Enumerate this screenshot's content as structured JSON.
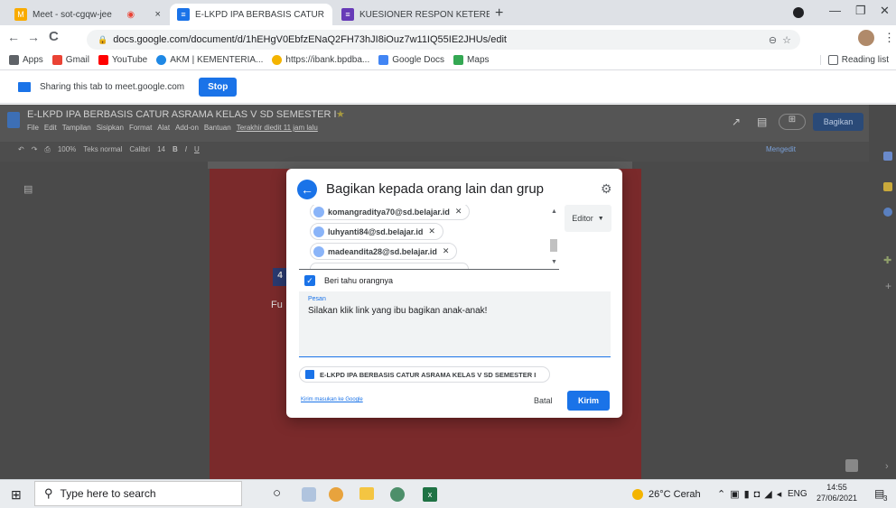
{
  "browser": {
    "tabs": [
      {
        "title": "Meet - sot-cgqw-jee",
        "close": "×",
        "fav_color": "#f9ab00"
      },
      {
        "title": "E-LKPD IPA BERBASIS CATUR",
        "close": "×",
        "fav_color": "#1a73e8"
      },
      {
        "title": "KUESIONER RESPON KETERBACA",
        "close": "×",
        "fav_color": "#673ab7"
      }
    ],
    "new_tab": "+",
    "url": "docs.google.com/document/d/1hEHgV0EbfzENaQ2FH73hJI8iOuz7w11IQ55IE2JHUs/edit",
    "bookmarks": [
      {
        "label": "Apps",
        "color": "#5f6368"
      },
      {
        "label": "Gmail",
        "color": "#ea4335"
      },
      {
        "label": "YouTube",
        "color": "#ff0000"
      },
      {
        "label": "AKM | KEMENTERIA...",
        "color": "#1e88e5"
      },
      {
        "label": "https://ibank.bpdba...",
        "color": "#f4b400"
      },
      {
        "label": "Google Docs",
        "color": "#4285f4"
      },
      {
        "label": "Maps",
        "color": "#34a853"
      }
    ],
    "reading_list": "Reading list"
  },
  "sharebar": {
    "text": "Sharing this tab to meet.google.com",
    "stop": "Stop"
  },
  "docs": {
    "title": "E-LKPD IPA BERBASIS CATUR ASRAMA KELAS V SD SEMESTER I",
    "menu": [
      "File",
      "Edit",
      "Tampilan",
      "Sisipkan",
      "Format",
      "Alat",
      "Add-on",
      "Bantuan"
    ],
    "last_edit": "Terakhir diedit 11 jam lalu",
    "share_button": "Bagikan",
    "zoom": "100%",
    "style": "Teks normal",
    "font": "Calibri",
    "font_size": "14",
    "mode": "Mengedit",
    "page_text_1": "4",
    "page_text_2": "Fu"
  },
  "dialog": {
    "title": "Bagikan kepada orang lain dan grup",
    "recipients": [
      "komangraditya70@sd.belajar.id",
      "luhyanti84@sd.belajar.id",
      "madeandita28@sd.belajar.id"
    ],
    "role": "Editor",
    "notify_label": "Beri tahu orangnya",
    "message_label": "Pesan",
    "message": "Silakan klik link yang ibu bagikan anak-anak!",
    "doc_chip": "E-LKPD IPA BERBASIS CATUR ASRAMA KELAS V SD SEMESTER I",
    "feedback": "Kirim masukan ke Google",
    "cancel": "Batal",
    "send": "Kirim"
  },
  "taskbar": {
    "search_placeholder": "Type here to search",
    "weather": "26°C  Cerah",
    "lang": "ENG",
    "time": "14:55",
    "date": "27/06/2021",
    "notif": "3"
  }
}
